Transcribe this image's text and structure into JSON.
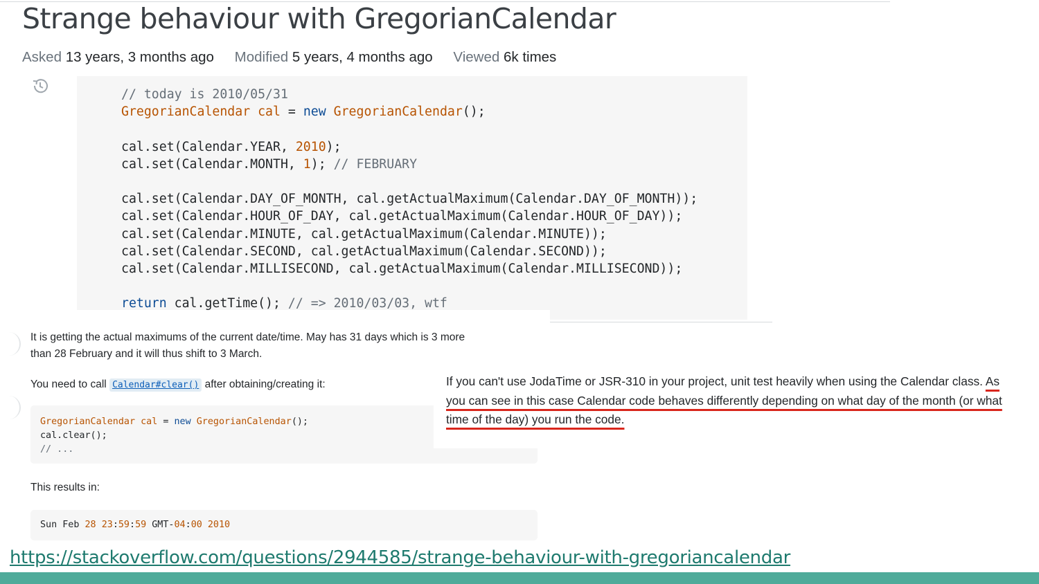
{
  "question": {
    "title": "Strange behaviour with GregorianCalendar",
    "asked_label": "Asked",
    "asked_value": "13 years, 3 months ago",
    "modified_label": "Modified",
    "modified_value": "5 years, 4 months ago",
    "viewed_label": "Viewed",
    "viewed_value": "6k times",
    "history_icon": "history-icon",
    "code_lines": [
      "// today is 2010/05/31",
      "GregorianCalendar cal = new GregorianCalendar();",
      "",
      "cal.set(Calendar.YEAR, 2010);",
      "cal.set(Calendar.MONTH, 1); // FEBRUARY",
      "",
      "cal.set(Calendar.DAY_OF_MONTH, cal.getActualMaximum(Calendar.DAY_OF_MONTH));",
      "cal.set(Calendar.HOUR_OF_DAY, cal.getActualMaximum(Calendar.HOUR_OF_DAY));",
      "cal.set(Calendar.MINUTE, cal.getActualMaximum(Calendar.MINUTE));",
      "cal.set(Calendar.SECOND, cal.getActualMaximum(Calendar.SECOND));",
      "cal.set(Calendar.MILLISECOND, cal.getActualMaximum(Calendar.MILLISECOND));",
      "",
      "return cal.getTime(); // => 2010/03/03, wtf"
    ]
  },
  "answer": {
    "para1_line1": "It is getting the actual maximums of the current date/time. May has 31 days which is 3 more",
    "para1_line2": "than 28 February and it will thus shift to 3 March.",
    "para2_before": "You need to call ",
    "para2_code": "Calendar#clear()",
    "para2_after": " after obtaining/creating it:",
    "code_lines": [
      "GregorianCalendar cal = new GregorianCalendar();",
      "cal.clear();",
      "// ..."
    ],
    "para3": "This results in:",
    "result_line": "Sun Feb 28 23:59:59 GMT-04:00 2010"
  },
  "comment": {
    "part1": "If you can't use JodaTime or JSR-310 in your project, unit test heavily when using the Calendar class. ",
    "part2_underlined": "As you can see in this case Calendar code behaves differently depending on what day of the month (or what time of the day) you run the code.",
    "underline_color": "#d9261c"
  },
  "source_link": "https://stackoverflow.com/questions/2944585/strange-behaviour-with-gregoriancalendar",
  "colors": {
    "footer_bar": "#4fab9a",
    "link": "#1e7a6e",
    "code_bg": "#f6f6f6"
  }
}
